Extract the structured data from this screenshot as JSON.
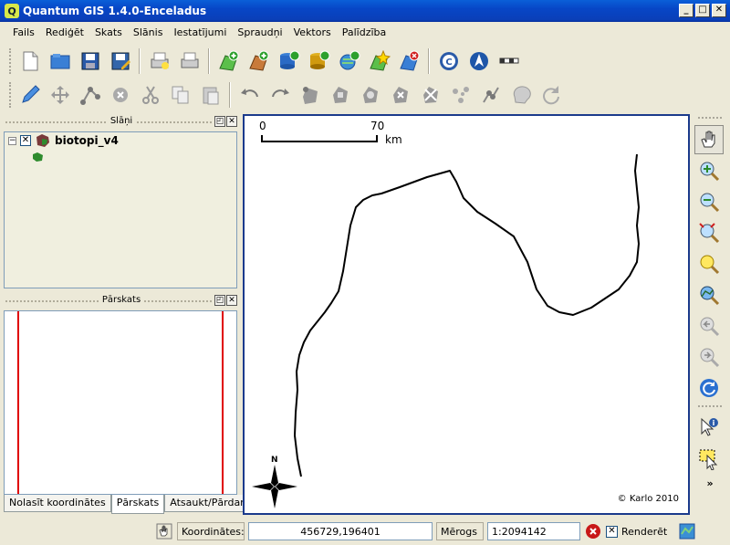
{
  "window": {
    "title": "Quantum GIS 1.4.0-Enceladus",
    "app_icon_glyph": "Q",
    "minimize": "_",
    "maximize": "□",
    "close": "✕"
  },
  "menu": [
    "Fails",
    "Rediģēt",
    "Skats",
    "Slānis",
    "Iestatījumi",
    "Spraudņi",
    "Vektors",
    "Palīdzība"
  ],
  "toolbar1": [
    "new-project-icon",
    "open-project-icon",
    "save-project-icon",
    "save-as-icon",
    "print-composer-icon",
    "print-icon",
    "add-vector-layer-icon",
    "add-raster-layer-icon",
    "add-postgis-layer-icon",
    "add-spatialite-layer-icon",
    "add-wms-layer-icon",
    "new-vector-layer-icon",
    "remove-layer-icon",
    "copyright-label-icon",
    "north-arrow-icon",
    "scale-bar-icon"
  ],
  "toolbar2": [
    "toggle-editing-icon",
    "move-feature-icon",
    "node-tool-icon",
    "delete-selected-icon",
    "cut-features-icon",
    "copy-features-icon",
    "paste-features-icon",
    "undo-icon",
    "redo-icon",
    "add-ring-icon",
    "add-island-icon",
    "delete-ring-icon",
    "delete-part-icon",
    "reshape-icon",
    "split-features-icon",
    "merge-features-icon",
    "simplify-icon",
    "rotate-label-icon",
    "rotate-point-icon"
  ],
  "layers_dock": {
    "title": "Slāņi",
    "float_btn": "◰",
    "close_btn": "✕",
    "expander": "−",
    "checkbox": "✕",
    "layers": [
      {
        "name": "biotopi_v4",
        "visible": true,
        "color": "#2e8b2e"
      }
    ]
  },
  "overview_dock": {
    "title": "Pārskats",
    "float_btn": "◰",
    "close_btn": "✕"
  },
  "tabs": [
    "Nolasīt koordinātes",
    "Pārskats",
    "Atsaukt/Pārdarīt"
  ],
  "active_tab": 1,
  "map": {
    "scale_start": "0",
    "scale_end": "70",
    "scale_unit": "km",
    "north_label": "N",
    "credit": "© Karlo 2010"
  },
  "right_toolbar": [
    "pan-icon",
    "zoom-in-icon",
    "zoom-out-icon",
    "zoom-full-icon",
    "zoom-to-selection-icon",
    "zoom-to-layer-icon",
    "zoom-last-icon",
    "zoom-next-icon",
    "refresh-icon",
    "identify-icon",
    "select-features-icon"
  ],
  "right_toolbar_more": "»",
  "status": {
    "coords_label": "Koordinātes:",
    "coords_value": "456729,196401",
    "scale_label": "Mērogs",
    "scale_value": "1:2094142",
    "stop_glyph": "✕",
    "render_checkbox": "✕",
    "render_label": "Renderēt"
  },
  "colors": {
    "titlebar": "#0a4fd0",
    "map_border": "#1b3a8c",
    "overview_line": "#e00000",
    "layer_fill": "#2e8b2e"
  }
}
